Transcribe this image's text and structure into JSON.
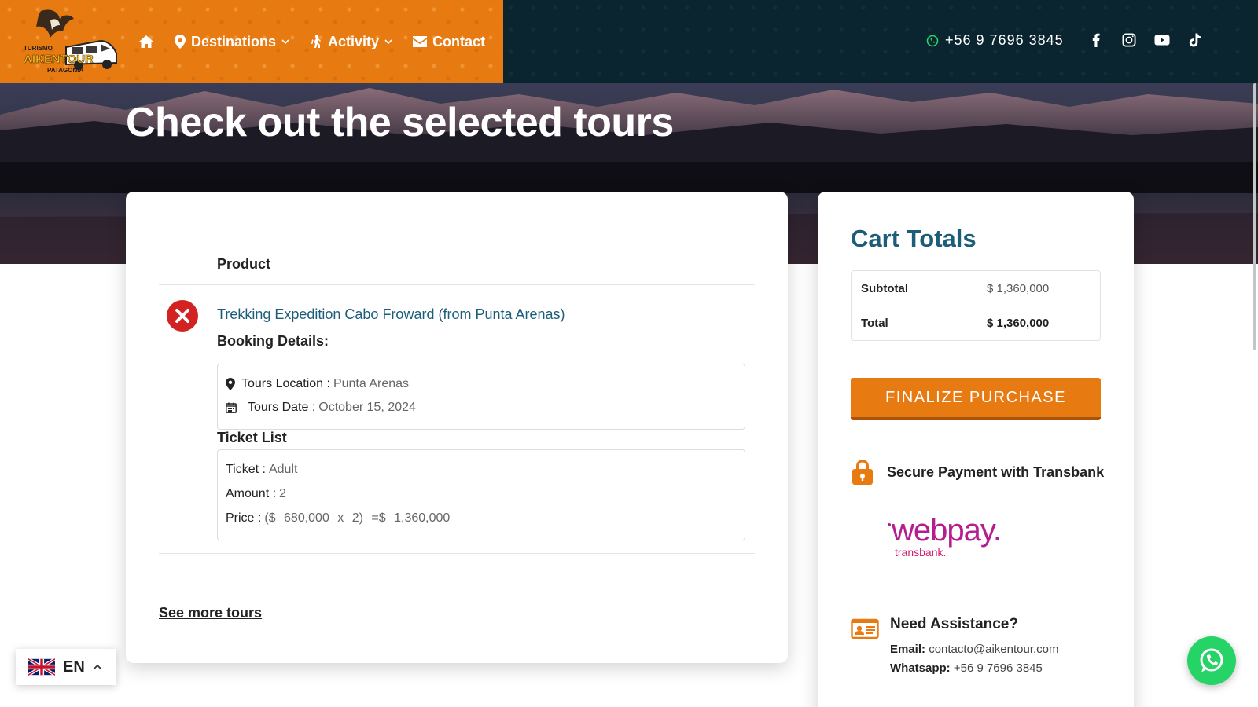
{
  "header": {
    "logo_lines": [
      "TURISMO",
      "AIKENTOUR",
      "PATAGONIA"
    ],
    "nav": [
      {
        "label": "Destinations"
      },
      {
        "label": "Activity"
      },
      {
        "label": "Contact"
      }
    ],
    "phone": "+56 9 7696 3845",
    "socials": [
      "facebook-icon",
      "instagram-icon",
      "youtube-icon",
      "tiktok-icon"
    ]
  },
  "hero": {
    "title": "Check out the selected tours"
  },
  "cart": {
    "column_header": "Product",
    "product_name": "Trekking Expedition Cabo Froward (from Punta Arenas)",
    "booking_title": "Booking Details:",
    "booking": [
      {
        "key": "Tours Location :",
        "value": "Punta Arenas",
        "icon": "map-pin-icon"
      },
      {
        "key": "Tours Date :",
        "value": "October 15, 2024",
        "icon": "calendar-icon"
      }
    ],
    "ticket_title": "Ticket List",
    "tickets": [
      {
        "key": "Ticket :",
        "value": "Adult"
      },
      {
        "key": "Amount :",
        "value": "2"
      },
      {
        "key": "Price :",
        "value": "($ 680,000 x 2) =$ 1,360,000"
      }
    ],
    "see_more": "See more tours"
  },
  "totals": {
    "title": "Cart Totals",
    "rows": [
      {
        "label": "Subtotal",
        "value": "$ 1,360,000"
      },
      {
        "label": "Total",
        "value": "$ 1,360,000"
      }
    ],
    "finalize_label": "FINALIZE PURCHASE",
    "secure_text": "Secure Payment with Transbank",
    "webpay_text": "webpay.",
    "transbank_text": "transbank.",
    "assist_title": "Need Assistance?",
    "email_label": "Email:",
    "email": "contacto@aikentour.com",
    "whatsapp_label": "Whatsapp:",
    "whatsapp": "+56 9 7696 3845"
  },
  "language": {
    "code": "EN"
  },
  "colors": {
    "accent": "#e87a12",
    "brand_dark": "#0a2530",
    "link": "#1c5d7a",
    "remove": "#d32222",
    "whatsapp": "#25d366",
    "webpay": "#b41e8e"
  }
}
